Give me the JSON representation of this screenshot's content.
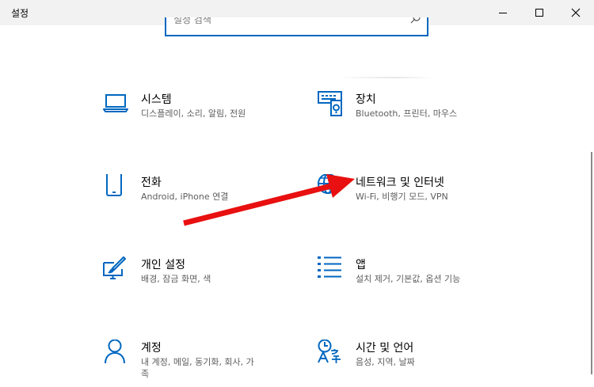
{
  "window": {
    "title": "설정",
    "controls": {
      "minimize": "minimize-icon",
      "maximize": "maximize-icon",
      "close": "close-icon"
    }
  },
  "search": {
    "placeholder": "설정 검색"
  },
  "tiles": [
    {
      "name": "시스템",
      "desc": "디스플레이, 소리, 알림, 전원",
      "icon": "laptop-icon"
    },
    {
      "name": "장치",
      "desc": "Bluetooth, 프린터, 마우스",
      "icon": "devices-icon"
    },
    {
      "name": "전화",
      "desc": "Android, iPhone 연결",
      "icon": "phone-icon"
    },
    {
      "name": "네트워크 및 인터넷",
      "desc": "Wi-Fi, 비행기 모드, VPN",
      "icon": "globe-icon"
    },
    {
      "name": "개인 설정",
      "desc": "배경, 잠금 화면, 색",
      "icon": "personalization-icon"
    },
    {
      "name": "앱",
      "desc": "설치 제거, 기본값, 옵션 기능",
      "icon": "apps-list-icon"
    },
    {
      "name": "계정",
      "desc": "내 계정, 메일, 동기화, 회사, 가\n족",
      "icon": "person-icon"
    },
    {
      "name": "시간 및 언어",
      "desc": "음성, 지역, 날짜",
      "icon": "time-language-icon"
    }
  ],
  "colors": {
    "accent": "#0067c0",
    "annotation_arrow": "#e81010",
    "titlebar": "#f2f2f2"
  }
}
